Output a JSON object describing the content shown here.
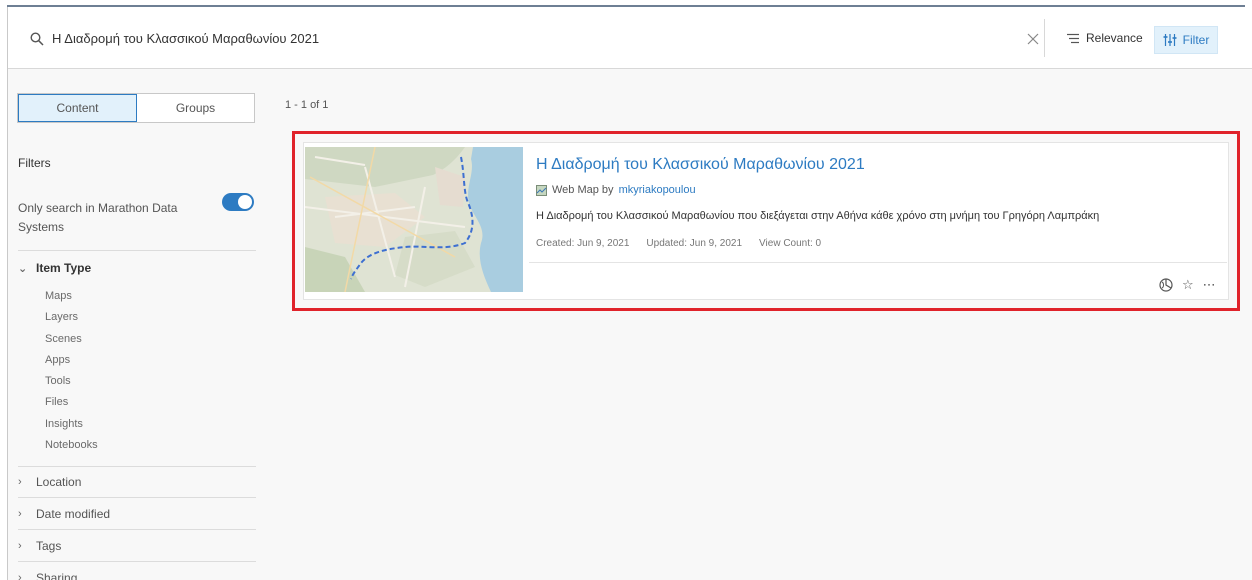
{
  "search": {
    "query": "Η Διαδρομή του Κλασσικού Μαραθωνίου 2021",
    "sort_label": "Relevance",
    "filter_label": "Filter"
  },
  "sidebar": {
    "tabs": [
      "Content",
      "Groups"
    ],
    "filters_title": "Filters",
    "only_search_label": "Only search in Marathon Data Systems",
    "item_type_label": "Item Type",
    "item_types": [
      "Maps",
      "Layers",
      "Scenes",
      "Apps",
      "Tools",
      "Files",
      "Insights",
      "Notebooks"
    ],
    "collapsed_groups": [
      "Location",
      "Date modified",
      "Tags",
      "Sharing"
    ]
  },
  "results": {
    "count_label": "1 - 1 of 1",
    "items": [
      {
        "title": "Η Διαδρομή του Κλασσικού Μαραθωνίου 2021",
        "type_prefix": "Web Map by",
        "owner": "mkyriakopoulou",
        "description": "Η Διαδρομή του Κλασσικού Μαραθωνίου που διεξάγεται στην Αθήνα κάθε χρόνο στη μνήμη του Γρηγόρη Λαμπράκη",
        "created": "Created: Jun 9, 2021",
        "updated": "Updated: Jun 9, 2021",
        "views": "View Count: 0"
      }
    ]
  },
  "colors": {
    "accent": "#2d7bc2",
    "highlight": "#e0232b"
  }
}
